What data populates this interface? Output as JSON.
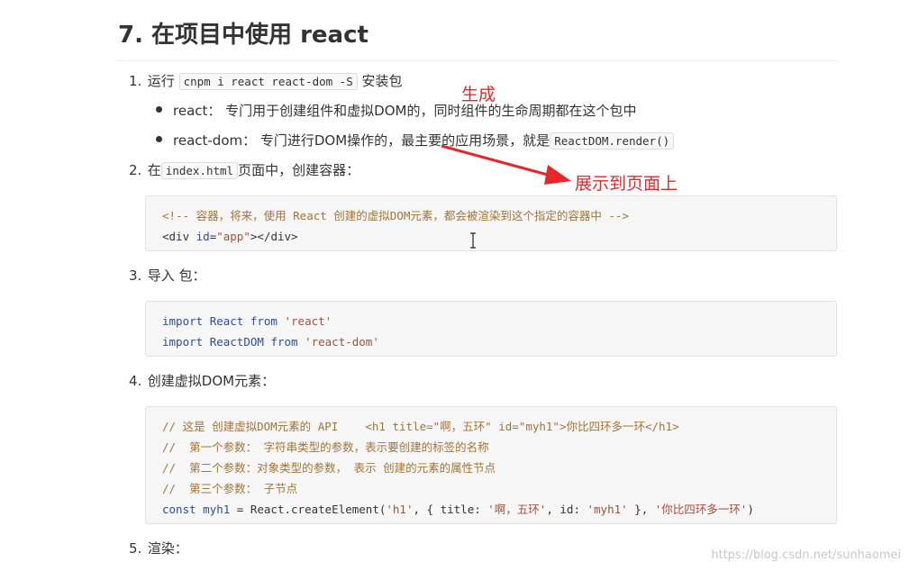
{
  "heading": "7. 在项目中使用 react",
  "steps": [
    {
      "num": "1.",
      "prefix": "运行",
      "code": "cnpm i react react-dom -S",
      "suffix": "安装包"
    },
    {
      "num": "2.",
      "prefix": "在",
      "code": "index.html",
      "suffix": "页面中，创建容器："
    },
    {
      "num": "3.",
      "text": "导入 包："
    },
    {
      "num": "4.",
      "text": "创建虚拟DOM元素："
    },
    {
      "num": "5.",
      "text": "渲染："
    }
  ],
  "bullets": [
    {
      "text": "react： 专门用于创建组件和虚拟DOM的，同时组件的生命周期都在这个包中"
    },
    {
      "text": "react-dom： 专门进行DOM操作的，最主要的应用场景，就是",
      "code": "ReactDOM.render()"
    }
  ],
  "code1": {
    "line1": "<!-- 容器，将来，使用 React 创建的虚拟DOM元素，都会被渲染到这个指定的容器中 -->",
    "line2_tag_open": "<div ",
    "line2_attr": "id",
    "line2_eq": "=",
    "line2_val": "\"app\"",
    "line2_tag_close": "></div>"
  },
  "code2": {
    "l1_kw": "import",
    "l1_name": "React",
    "l1_from": "from",
    "l1_str": "'react'",
    "l2_kw": "import",
    "l2_name": "ReactDOM",
    "l2_from": "from",
    "l2_str": "'react-dom'"
  },
  "code3": {
    "c1": "// 这是 创建虚拟DOM元素的 API    <h1 title=\"啊，五环\" id=\"myh1\">你比四环多一环</h1>",
    "c2": "//  第一个参数： 字符串类型的参数，表示要创建的标签的名称",
    "c3": "//  第二个参数：对象类型的参数， 表示 创建的元素的属性节点",
    "c4": "//  第三个参数： 子节点",
    "l5_kw": "const",
    "l5_var": "myh1",
    "l5_rest1": " = React.createElement(",
    "l5_s1": "'h1'",
    "l5_rest2": ", { title: ",
    "l5_s2": "'啊，五环'",
    "l5_rest3": ", id: ",
    "l5_s3": "'myh1'",
    "l5_rest4": " }, ",
    "l5_s4": "'你比四环多一环'",
    "l5_rest5": ")"
  },
  "annotations": {
    "top": "生成",
    "right": "展示到页面上",
    "color": "#e8262a"
  },
  "watermark": "https://blog.csdn.net/sunhaomei"
}
